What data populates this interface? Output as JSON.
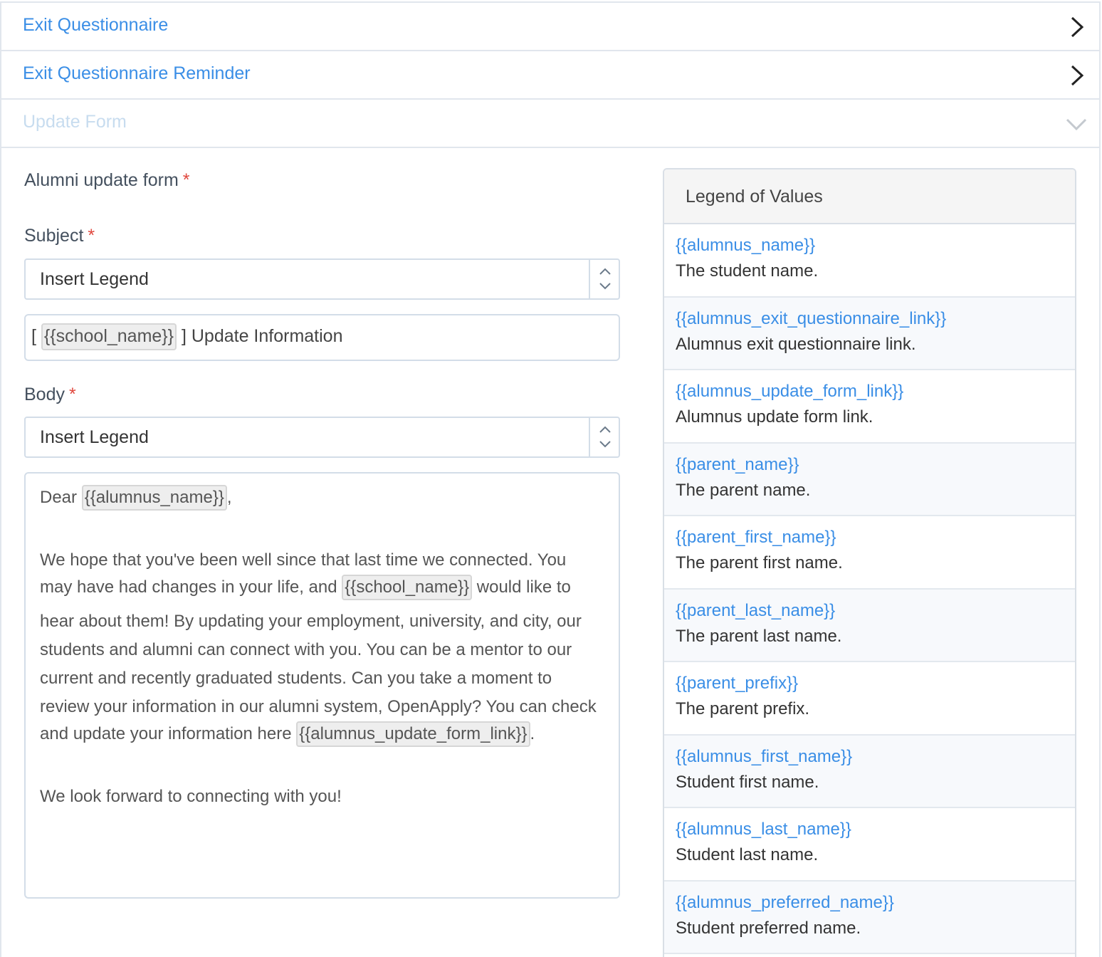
{
  "accordion": [
    {
      "title": "Exit Questionnaire",
      "state": "collapsed"
    },
    {
      "title": "Exit Questionnaire Reminder",
      "state": "collapsed"
    },
    {
      "title": "Update Form",
      "state": "expanded"
    }
  ],
  "form": {
    "section_title": "Alumni update form",
    "required_mark": "*",
    "subject": {
      "label": "Subject",
      "insert_legend": "Insert Legend",
      "value": {
        "prefix": "[",
        "token": "{{school_name}}",
        "suffix": "] Update Information"
      }
    },
    "body": {
      "label": "Body",
      "insert_legend": "Insert Legend",
      "greeting": {
        "word": "Dear",
        "token": "{{alumnus_name}}",
        "punct": ","
      },
      "paragraph": {
        "line1": "We hope that you've been well since that last time we connected. You",
        "line2_a": "may have had changes in your life, and",
        "line2_token": "{{school_name}}",
        "line2_b": "would like to",
        "line3": "hear about them! By updating your employment, university, and city, our",
        "line4": "students and alumni can connect with you. You can be a mentor to our",
        "line5": "current and recently graduated students. Can you take a moment to",
        "line6": "review your information in our alumni system, OpenApply? You can check",
        "line7_a": "and update your information here",
        "line7_token": "{{alumnus_update_form_link}}",
        "line7_b": "."
      },
      "closing": "We look forward to connecting with you!"
    }
  },
  "legend": {
    "title": "Legend of Values",
    "items": [
      {
        "key": "{{alumnus_name}}",
        "desc": "The student name."
      },
      {
        "key": "{{alumnus_exit_questionnaire_link}}",
        "desc": "Alumnus exit questionnaire link."
      },
      {
        "key": "{{alumnus_update_form_link}}",
        "desc": "Alumnus update form link."
      },
      {
        "key": "{{parent_name}}",
        "desc": "The parent name."
      },
      {
        "key": "{{parent_first_name}}",
        "desc": "The parent first name."
      },
      {
        "key": "{{parent_last_name}}",
        "desc": "The parent last name."
      },
      {
        "key": "{{parent_prefix}}",
        "desc": "The parent prefix."
      },
      {
        "key": "{{alumnus_first_name}}",
        "desc": "Student first name."
      },
      {
        "key": "{{alumnus_last_name}}",
        "desc": "Student last name."
      },
      {
        "key": "{{alumnus_preferred_name}}",
        "desc": "Student preferred name."
      }
    ]
  },
  "colors": {
    "link": "#3a8ee6",
    "required": "#e0483e",
    "border": "#d3dde8"
  }
}
